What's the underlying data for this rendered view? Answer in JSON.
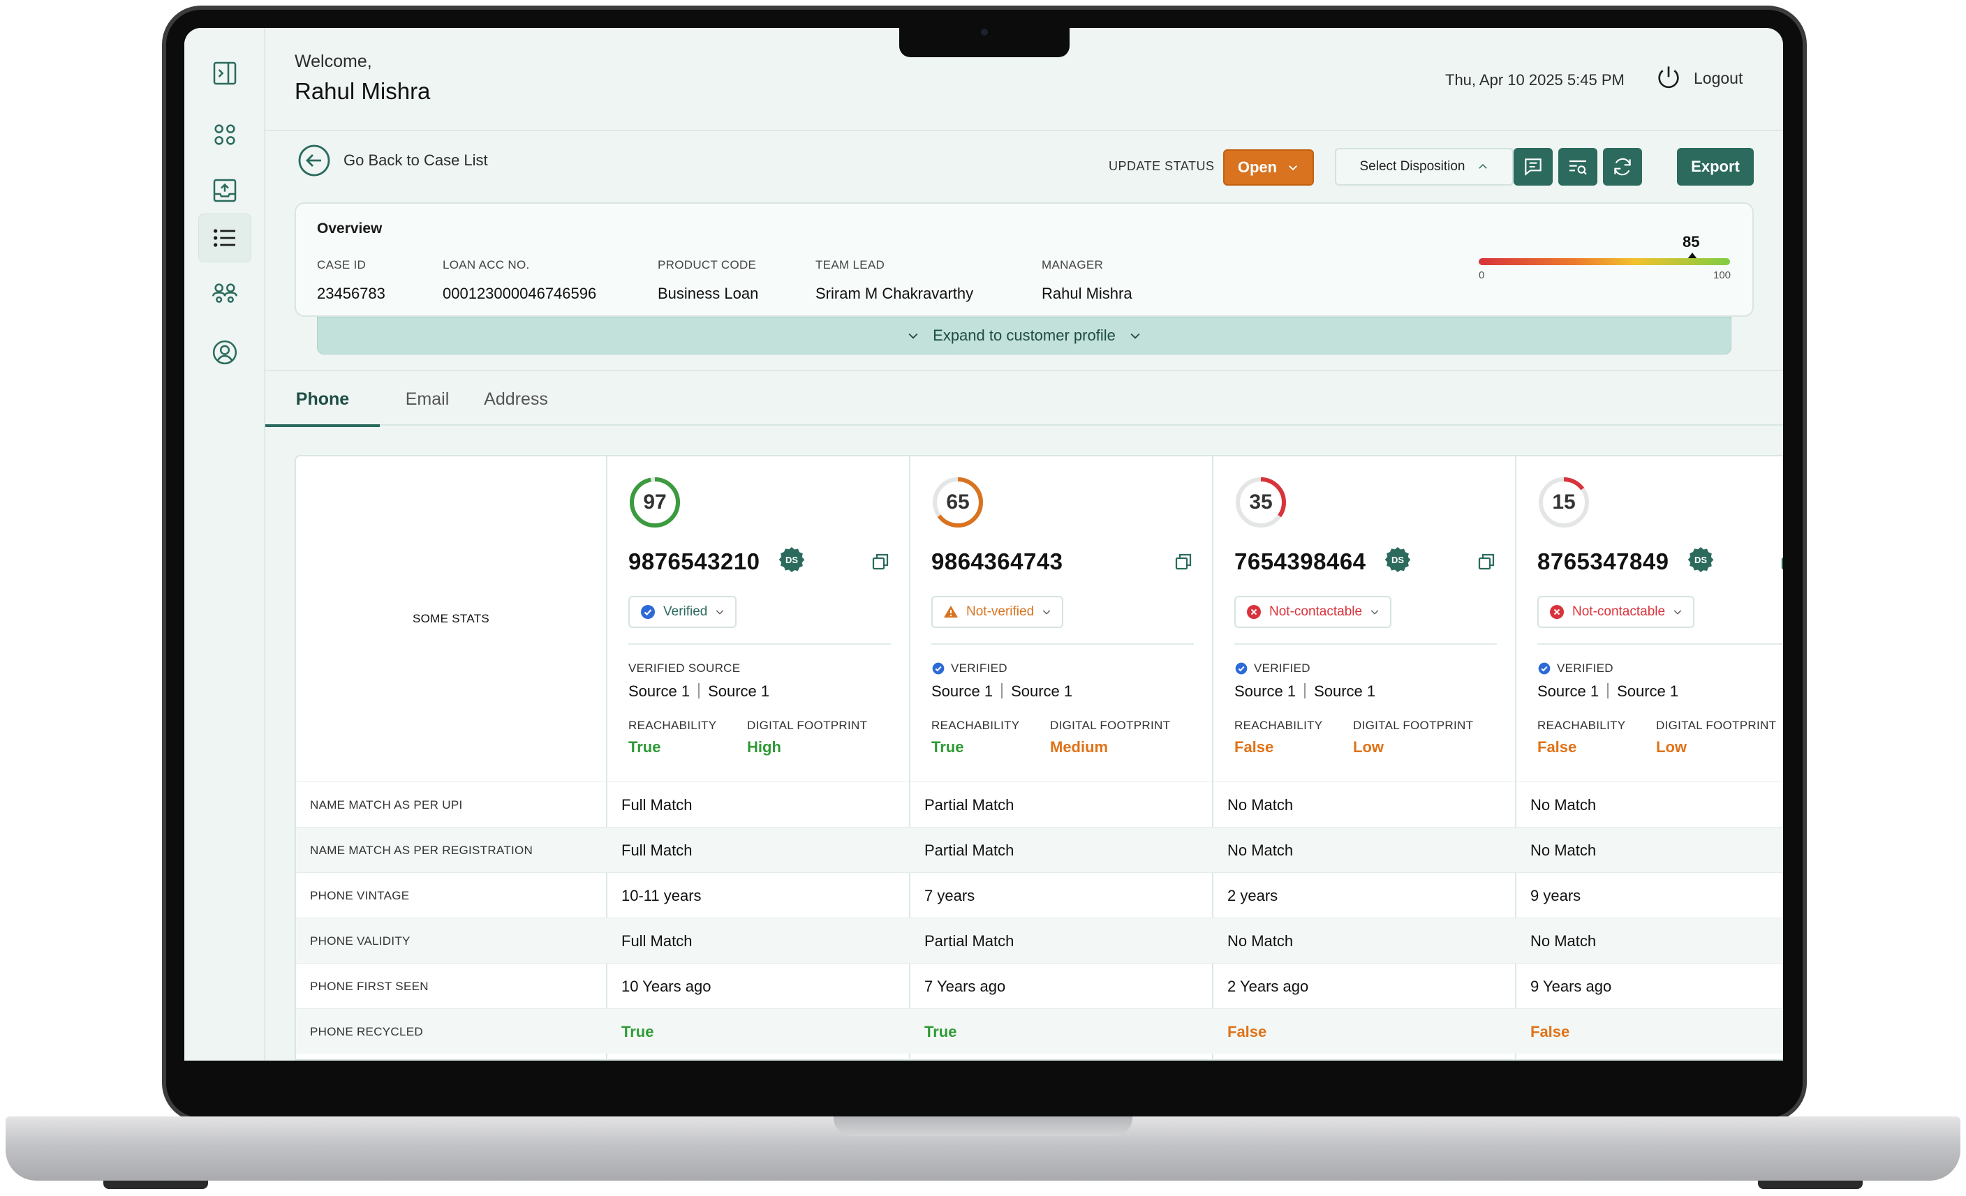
{
  "header": {
    "welcome": "Welcome,",
    "user_name": "Rahul Mishra",
    "datetime": "Thu, Apr 10 2025 5:45 PM",
    "logout": "Logout"
  },
  "toolbar": {
    "back": "Go Back to Case List",
    "update_status_label": "UPDATE STATUS",
    "status_value": "Open",
    "disposition_placeholder": "Select Disposition",
    "export": "Export"
  },
  "overview": {
    "title": "Overview",
    "fields": [
      {
        "label": "CASE ID",
        "value": "23456783"
      },
      {
        "label": "LOAN ACC NO.",
        "value": "000123000046746596"
      },
      {
        "label": "PRODUCT CODE",
        "value": "Business Loan"
      },
      {
        "label": "TEAM LEAD",
        "value": "Sriram M Chakravarthy"
      },
      {
        "label": "MANAGER",
        "value": "Rahul Mishra"
      }
    ],
    "score": {
      "value": 85,
      "min": "0",
      "max": "100"
    },
    "expand": "Expand to customer profile"
  },
  "tabs": [
    "Phone",
    "Email",
    "Address"
  ],
  "table": {
    "stats_header": "SOME STATS",
    "columns": [
      {
        "score": 97,
        "score_color": "#3c9a3f",
        "phone": "9876543210",
        "badge": "DS",
        "status": "Verified",
        "status_icon": "verified-badge-icon",
        "status_color": "#2b6a5d",
        "verified_label": "VERIFIED SOURCE",
        "source_1": "Source 1",
        "source_2": "Source 1",
        "reach_label": "REACHABILITY",
        "reach": "True",
        "foot_label": "DIGITAL FOOTPRINT",
        "foot": "High"
      },
      {
        "score": 65,
        "score_color": "#d9731f",
        "phone": "9864364743",
        "badge": "",
        "status": "Not-verified",
        "status_icon": "warning-icon",
        "status_color": "#d9731f",
        "verified_label": "VERIFIED",
        "source_1": "Source 1",
        "source_2": "Source 1",
        "reach_label": "REACHABILITY",
        "reach": "True",
        "foot_label": "DIGITAL FOOTPRINT",
        "foot": "Medium"
      },
      {
        "score": 35,
        "score_color": "#d8333b",
        "phone": "7654398464",
        "badge": "DS",
        "status": "Not-contactable",
        "status_icon": "error-icon",
        "status_color": "#d8333b",
        "verified_label": "VERIFIED",
        "source_1": "Source 1",
        "source_2": "Source 1",
        "reach_label": "REACHABILITY",
        "reach": "False",
        "foot_label": "DIGITAL FOOTPRINT",
        "foot": "Low"
      },
      {
        "score": 15,
        "score_color": "#d8333b",
        "phone": "8765347849",
        "badge": "DS",
        "status": "Not-contactable",
        "status_icon": "error-icon",
        "status_color": "#d8333b",
        "verified_label": "VERIFIED",
        "source_1": "Source 1",
        "source_2": "Source 1",
        "reach_label": "REACHABILITY",
        "reach": "False",
        "foot_label": "DIGITAL FOOTPRINT",
        "foot": "Low"
      }
    ],
    "rows": [
      {
        "label": "NAME MATCH AS PER UPI",
        "values": [
          "Full Match",
          "Partial Match",
          "No Match",
          "No Match"
        ]
      },
      {
        "label": "NAME MATCH AS PER REGISTRATION",
        "values": [
          "Full Match",
          "Partial Match",
          "No Match",
          "No Match"
        ]
      },
      {
        "label": "PHONE VINTAGE",
        "values": [
          "10-11 years",
          "7 years",
          "2 years",
          "9 years"
        ]
      },
      {
        "label": "PHONE VALIDITY",
        "values": [
          "Full Match",
          "Partial Match",
          "No Match",
          "No Match"
        ]
      },
      {
        "label": "PHONE FIRST SEEN",
        "values": [
          "10 Years ago",
          "7 Years ago",
          "2 Years ago",
          "9 Years ago"
        ]
      },
      {
        "label": "PHONE RECYCLED",
        "values": [
          "True",
          "True",
          "False",
          "False"
        ]
      }
    ]
  },
  "colors": {
    "brand": "#2b6a5d",
    "accent": "#d9731f",
    "good": "#2f9a36",
    "bad": "#e07319"
  }
}
